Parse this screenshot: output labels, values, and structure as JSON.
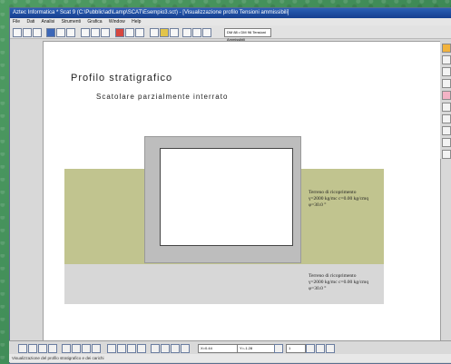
{
  "window": {
    "title": "Aztec Informatica * Scat 9 (C:\\Pubblic\\ad\\Lamp\\SCAT\\Esempio3.sct) - [Visualizzazione profilo Tensioni ammissibili]",
    "menu": [
      "File",
      "Dati",
      "Analisi",
      "Strumenti",
      "Grafica",
      "Window",
      "Help"
    ]
  },
  "toolbar": {
    "combo_value": "DM 88 • DM 96 Tensioni Ammissibili"
  },
  "drawing": {
    "title": "Profilo stratigrafico",
    "subtitle": "Scatolare parzialmente interrato",
    "label_top": {
      "line1": "Terreno di ricoprimento",
      "line2": "γ=2000 kg/mc  c=0.00 kg/cmq",
      "line3": "φ=30.0 °"
    },
    "label_bottom": {
      "line1": "Terreno di ricoprimento",
      "line2": "γ=2000 kg/mc  c=0.00 kg/cmq",
      "line3": "φ=30.0 °"
    }
  },
  "bottom_toolbar": {
    "x_coord": "X=0.44",
    "y_coord": "Y=-1.28",
    "zoom": "1"
  },
  "status": {
    "text": "Visualizzazione del profilo stratigrafico e dei carichi"
  }
}
